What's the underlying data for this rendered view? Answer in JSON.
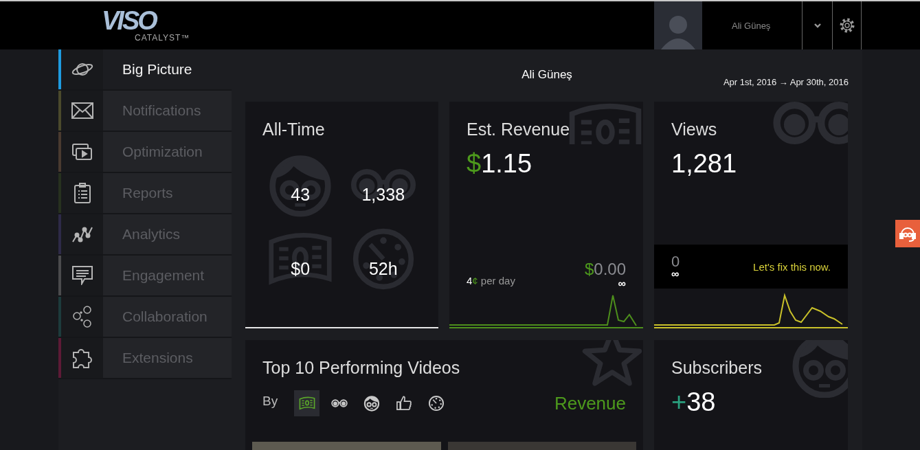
{
  "header": {
    "logo": {
      "wordmark": "VISO",
      "subtitle": "CATALYST™"
    },
    "user_name": "Ali Güneş"
  },
  "sidebar": {
    "items": [
      {
        "label": "Big Picture",
        "selected": true,
        "color": "#1e9be0"
      },
      {
        "label": "Notifications",
        "selected": false,
        "color": "#4b4a2c"
      },
      {
        "label": "Optimization",
        "selected": false,
        "color": "#4a3a30"
      },
      {
        "label": "Reports",
        "selected": false,
        "color": "#27311f"
      },
      {
        "label": "Analytics",
        "selected": false,
        "color": "#2e2a48"
      },
      {
        "label": "Engagement",
        "selected": false,
        "color": "#4b4b4d"
      },
      {
        "label": "Collaboration",
        "selected": false,
        "color": "#1d3b3c"
      },
      {
        "label": "Extensions",
        "selected": false,
        "color": "#5d1a36"
      }
    ]
  },
  "page": {
    "title": "Ali Güneş",
    "date_range": "Apr 1st, 2016 → Apr 30th, 2016"
  },
  "all_time": {
    "title": "All-Time",
    "stats": [
      {
        "kind": "subscribers",
        "value": "43"
      },
      {
        "kind": "views",
        "value": "1,338"
      },
      {
        "kind": "revenue",
        "value": "$0"
      },
      {
        "kind": "watch_time",
        "value": "52h"
      }
    ]
  },
  "revenue": {
    "title": "Est. Revenue",
    "currency": "$",
    "amount": "1.15",
    "per_day_value": "4",
    "per_day_unit": "¢",
    "per_day_label": "per day",
    "goal_currency": "$",
    "goal_amount": "0.00",
    "goal_period": "∞"
  },
  "views": {
    "title": "Views",
    "value": "1,281",
    "goal": "0",
    "goal_period": "∞",
    "cta": "Let's fix this now."
  },
  "top_videos": {
    "title": "Top 10 Performing Videos",
    "by_label": "By",
    "sort_options": [
      {
        "kind": "revenue",
        "selected": true
      },
      {
        "kind": "views",
        "selected": false
      },
      {
        "kind": "subscribers",
        "selected": false
      },
      {
        "kind": "likes",
        "selected": false
      },
      {
        "kind": "watch_time",
        "selected": false
      }
    ],
    "current_sort": "Revenue"
  },
  "subscribers": {
    "title": "Subscribers",
    "sign": "+",
    "value": "38"
  }
}
